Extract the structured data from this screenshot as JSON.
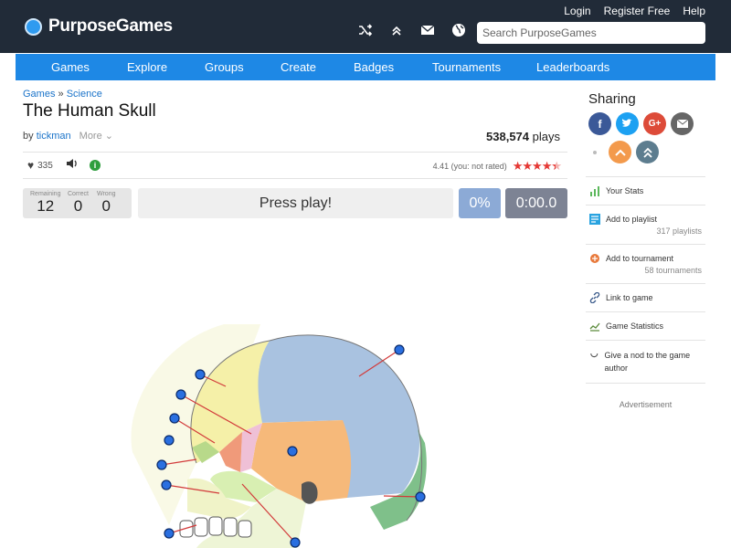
{
  "header": {
    "logo_text": "PurposeGames",
    "search_placeholder": "Search PurposeGames",
    "links": [
      "Login",
      "Register Free",
      "Help"
    ],
    "icons": [
      "shuffle-icon",
      "chevrons-up-icon",
      "mail-icon",
      "globe-icon"
    ]
  },
  "nav": {
    "items": [
      "Games",
      "Explore",
      "Groups",
      "Create",
      "Badges",
      "Tournaments",
      "Leaderboards"
    ]
  },
  "breadcrumb": {
    "first": "Games",
    "separator": "»",
    "second": "Science"
  },
  "game": {
    "title": "The Human Skull",
    "by_label": "by",
    "author": "tickman",
    "more_label": "More",
    "plays_count": "538,574",
    "plays_label": "plays",
    "likes": "335",
    "rating_text": "4.41 (you: not rated)",
    "rating_value": 4.41,
    "rating_max": 5
  },
  "stats": {
    "remaining_label": "Remaining",
    "remaining": "12",
    "correct_label": "Correct",
    "correct": "0",
    "wrong_label": "Wrong",
    "wrong": "0",
    "press_play": "Press play!",
    "percent": "0%",
    "timer": "0:00.0"
  },
  "sidebar": {
    "sharing_title": "Sharing",
    "share_icons": [
      "facebook-icon",
      "twitter-icon",
      "google-plus-icon",
      "email-icon",
      "upvote-icon",
      "boost-icon"
    ],
    "items": [
      {
        "label": "Your Stats",
        "sub": ""
      },
      {
        "label": "Add to playlist",
        "sub": "317 playlists"
      },
      {
        "label": "Add to tournament",
        "sub": "58 tournaments"
      },
      {
        "label": "Link to game",
        "sub": ""
      },
      {
        "label": "Game Statistics",
        "sub": ""
      },
      {
        "label": "Give a nod to the game author",
        "sub": ""
      }
    ],
    "advertisement": "Advertisement"
  },
  "colors": {
    "header_bg": "#212b38",
    "nav_bg": "#1e88e5",
    "link": "#1a73c9",
    "star": "#e53935",
    "marker": "#1e6fe0"
  }
}
